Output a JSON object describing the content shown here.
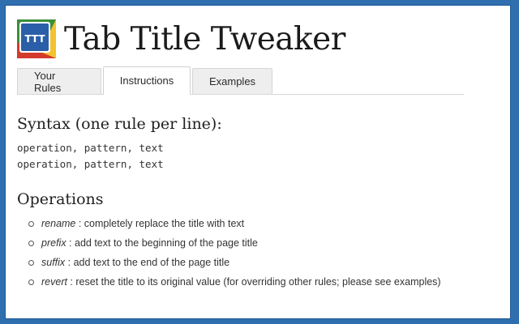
{
  "app": {
    "title": "Tab Title Tweaker",
    "logo_text": "TTT",
    "logo_colors": {
      "blue": "#2a5ea8",
      "green": "#3b8f3b",
      "yellow": "#f2c230",
      "red": "#d33b2c"
    }
  },
  "tabs": [
    {
      "label": "Your Rules",
      "active": false
    },
    {
      "label": "Instructions",
      "active": true
    },
    {
      "label": "Examples",
      "active": false
    }
  ],
  "syntax": {
    "heading": "Syntax (one rule per line):",
    "lines": [
      "operation, pattern, text",
      "operation, pattern, text"
    ]
  },
  "operations": {
    "heading": "Operations",
    "items": [
      {
        "name": "rename",
        "desc": " : completely replace the title with text"
      },
      {
        "name": "prefix",
        "desc": " : add text to the beginning of the page title"
      },
      {
        "name": "suffix",
        "desc": " : add text to the end of the page title"
      },
      {
        "name": "revert",
        "desc": " : reset the title to its original value (for overriding other rules; please see examples)"
      }
    ]
  }
}
